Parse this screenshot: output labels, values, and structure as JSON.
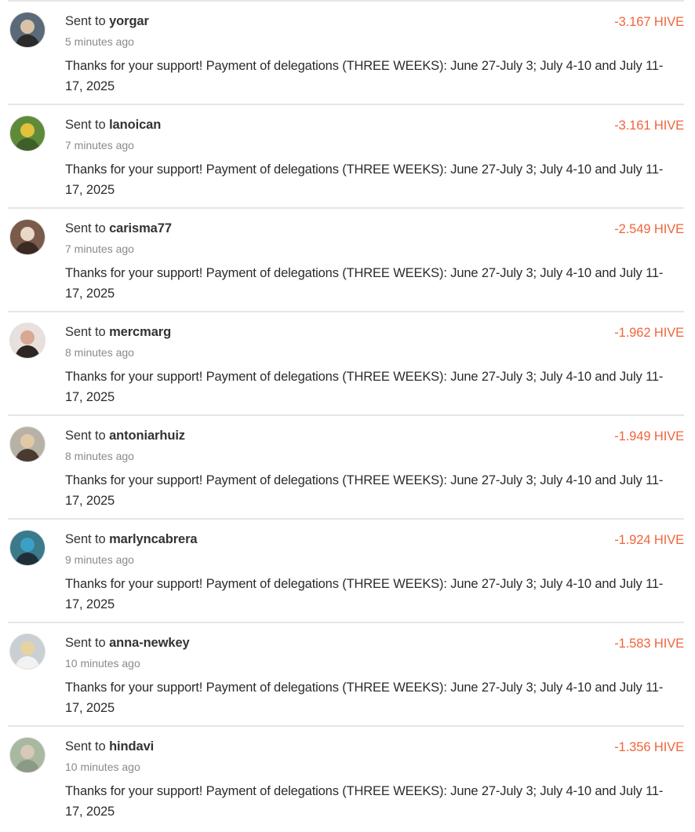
{
  "transfers": [
    {
      "prefix": "Sent to ",
      "user": "yorgar",
      "time": "5 minutes ago",
      "amount": "-3.167 HIVE",
      "memo": "Thanks for your support! Payment of delegations (THREE WEEKS): June 27-July 3; July 4-10 and July 11-17, 2025",
      "avatar_colors": [
        "#5b6a78",
        "#d9c3a8",
        "#2b2b2b"
      ]
    },
    {
      "prefix": "Sent to ",
      "user": "lanoican",
      "time": "7 minutes ago",
      "amount": "-3.161 HIVE",
      "memo": "Thanks for your support! Payment of delegations (THREE WEEKS): June 27-July 3; July 4-10 and July 11-17, 2025",
      "avatar_colors": [
        "#5f8a3a",
        "#e2c23a",
        "#3f5f2a"
      ]
    },
    {
      "prefix": "Sent to ",
      "user": "carisma77",
      "time": "7 minutes ago",
      "amount": "-2.549 HIVE",
      "memo": "Thanks for your support! Payment of delegations (THREE WEEKS): June 27-July 3; July 4-10 and July 11-17, 2025",
      "avatar_colors": [
        "#7a5a4a",
        "#e9d7c8",
        "#3a2a22"
      ]
    },
    {
      "prefix": "Sent to ",
      "user": "mercmarg",
      "time": "8 minutes ago",
      "amount": "-1.962 HIVE",
      "memo": "Thanks for your support! Payment of delegations (THREE WEEKS): June 27-July 3; July 4-10 and July 11-17, 2025",
      "avatar_colors": [
        "#e8e0dc",
        "#d8a894",
        "#2e2622"
      ]
    },
    {
      "prefix": "Sent to ",
      "user": "antoniarhuiz",
      "time": "8 minutes ago",
      "amount": "-1.949 HIVE",
      "memo": "Thanks for your support! Payment of delegations (THREE WEEKS): June 27-July 3; July 4-10 and July 11-17, 2025",
      "avatar_colors": [
        "#b8b2a6",
        "#e3c8a8",
        "#4a3a30"
      ]
    },
    {
      "prefix": "Sent to ",
      "user": "marlyncabrera",
      "time": "9 minutes ago",
      "amount": "-1.924 HIVE",
      "memo": "Thanks for your support! Payment of delegations (THREE WEEKS): June 27-July 3; July 4-10 and July 11-17, 2025",
      "avatar_colors": [
        "#3a7a8a",
        "#3aa0c8",
        "#1f2f3a"
      ]
    },
    {
      "prefix": "Sent to ",
      "user": "anna-newkey",
      "time": "10 minutes ago",
      "amount": "-1.583 HIVE",
      "memo": "Thanks for your support! Payment of delegations (THREE WEEKS): June 27-July 3; July 4-10 and July 11-17, 2025",
      "avatar_colors": [
        "#c8d0d6",
        "#e8d2a0",
        "#f2f2f2"
      ]
    },
    {
      "prefix": "Sent to ",
      "user": "hindavi",
      "time": "10 minutes ago",
      "amount": "-1.356 HIVE",
      "memo": "Thanks for your support! Payment of delegations (THREE WEEKS): June 27-July 3; July 4-10 and July 11-17, 2025",
      "avatar_colors": [
        "#a9b8a0",
        "#d6c9b8",
        "#8a9a86"
      ]
    }
  ]
}
